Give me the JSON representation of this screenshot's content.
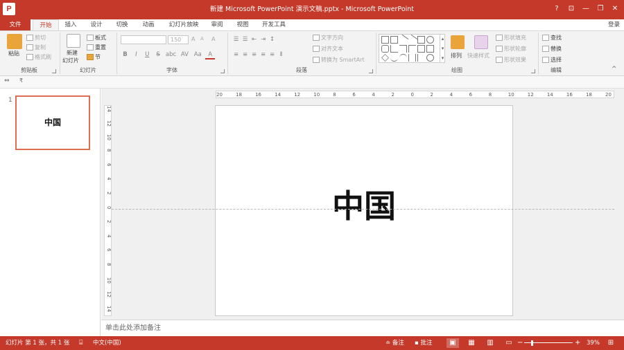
{
  "title_bar": {
    "app_icon_letter": "P",
    "title": "新建 Microsoft PowerPoint 演示文稿.pptx - Microsoft PowerPoint",
    "help": "?",
    "ribbon_display": "⊡",
    "minimize": "—",
    "restore": "❐",
    "close": "✕"
  },
  "tabs": {
    "file": "文件",
    "items": [
      "开始",
      "插入",
      "设计",
      "切换",
      "动画",
      "幻灯片放映",
      "审阅",
      "视图",
      "开发工具"
    ],
    "active": "开始",
    "login": "登录"
  },
  "ribbon": {
    "clipboard": {
      "paste": "粘贴",
      "cut": "剪切",
      "copy": "复制",
      "format_painter": "格式刷",
      "label": "剪贴板"
    },
    "slides": {
      "new_slide_line1": "新建",
      "new_slide_line2": "幻灯片",
      "layout": "板式",
      "reset": "重置",
      "section": "节",
      "label": "幻灯片"
    },
    "font": {
      "font_name": "",
      "font_size": "150",
      "bold": "B",
      "italic": "I",
      "underline": "U",
      "strike": "S",
      "shadow": "abc",
      "spacing": "AV",
      "case": "Aa",
      "grow": "A",
      "shrink": "A",
      "clear": "A",
      "color": "A",
      "label": "字体"
    },
    "paragraph": {
      "text_direction": "文字方向",
      "align_text": "对齐文本",
      "smartart": "转换为 SmartArt",
      "label": "段落"
    },
    "drawing": {
      "arrange": "排列",
      "quick_styles": "快速样式",
      "shape_fill": "形状填充",
      "shape_outline": "形状轮廓",
      "shape_effects": "形状效果",
      "label": "绘图"
    },
    "editing": {
      "find": "查找",
      "replace": "替换",
      "select": "选择",
      "label": "编辑"
    },
    "collapse": "^"
  },
  "qat": {
    "pin": "⇔",
    "dropdown": "₹"
  },
  "thumbnails": [
    {
      "number": "1",
      "text": "中国"
    }
  ],
  "rulers": {
    "horizontal": [
      "20",
      "18",
      "16",
      "14",
      "12",
      "10",
      "8",
      "6",
      "4",
      "2",
      "0",
      "2",
      "4",
      "6",
      "8",
      "10",
      "12",
      "14",
      "16",
      "18",
      "20"
    ],
    "vertical": [
      "14",
      "12",
      "10",
      "8",
      "6",
      "4",
      "2",
      "0",
      "2",
      "4",
      "6",
      "8",
      "10",
      "12",
      "14"
    ]
  },
  "slide": {
    "title": "中国"
  },
  "notes": {
    "placeholder": "单击此处添加备注"
  },
  "status_bar": {
    "slide_info": "幻灯片 第 1 张，共 1 张",
    "language": "中文(中国)",
    "notes": "备注",
    "comments": "批注",
    "zoom_minus": "−",
    "zoom_plus": "+",
    "zoom_level": "39%"
  },
  "colors": {
    "accent": "#c4392a",
    "thumb_border": "#e06c54"
  }
}
